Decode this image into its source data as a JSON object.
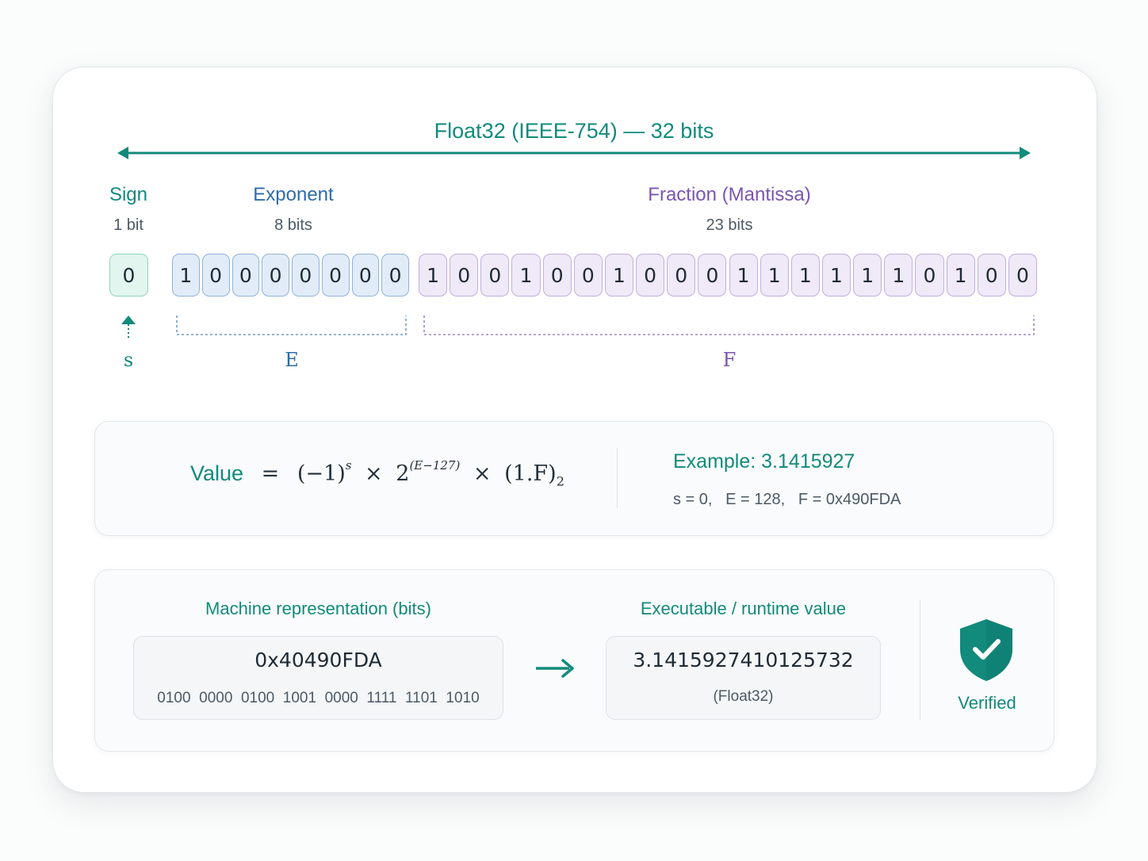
{
  "header": {
    "title": "Float32 (IEEE-754) — 32 bits"
  },
  "fields": {
    "sign": {
      "name": "Sign",
      "bits_label": "1 bit",
      "symbol": "s"
    },
    "exponent": {
      "name": "Exponent",
      "bits_label": "8 bits",
      "symbol": "E"
    },
    "fraction": {
      "name": "Fraction (Mantissa)",
      "bits_label": "23 bits",
      "symbol": "F"
    }
  },
  "bits": {
    "sign": [
      "0"
    ],
    "exponent": [
      "1",
      "0",
      "0",
      "0",
      "0",
      "0",
      "0",
      "0"
    ],
    "fraction": [
      "1",
      "0",
      "0",
      "1",
      "0",
      "0",
      "1",
      "0",
      "0",
      "0",
      "1",
      "1",
      "1",
      "1",
      "1",
      "1",
      "0",
      "1",
      "0",
      "0"
    ]
  },
  "formula": {
    "label": "Value",
    "equals": "=",
    "base_term": "(−1)",
    "base_exp": "s",
    "times1": "×",
    "two": "2",
    "two_exp": "(E−127)",
    "times2": "×",
    "mantissa": "(1.F)",
    "mantissa_sub": "2"
  },
  "example": {
    "title": "Example:  3.1415927",
    "details": "s = 0,   E = 128,   F = 0x490FDA"
  },
  "machine": {
    "heading": "Machine representation (bits)",
    "hex": "0x40490FDA",
    "binary": "0100  0000  0100  1001  0000  1111  1101  1010"
  },
  "runtime": {
    "heading": "Executable / runtime value",
    "value": "3.1415927410125732",
    "type": "(Float32)"
  },
  "status": {
    "label": "Verified",
    "icon": "shield-check-icon"
  },
  "colors": {
    "teal": "#128a7c",
    "blue": "#2f6cab",
    "purple": "#7a55b0"
  }
}
